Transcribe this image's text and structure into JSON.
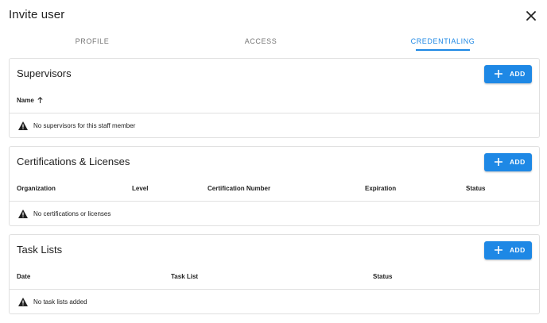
{
  "dialog": {
    "title": "Invite user",
    "close_icon": "close-icon"
  },
  "tabs": [
    {
      "label": "PROFILE",
      "active": false
    },
    {
      "label": "ACCESS",
      "active": false
    },
    {
      "label": "CREDENTIALING",
      "active": true
    }
  ],
  "colors": {
    "accent": "#1e88e5",
    "text": "#212121",
    "muted": "#757575",
    "border": "#e0e0e0"
  },
  "supervisors": {
    "title": "Supervisors",
    "add_label": "ADD",
    "columns": [
      "Name"
    ],
    "sort_icon": "arrow-up-icon",
    "empty_message": "No supervisors for this staff member"
  },
  "certifications": {
    "title": "Certifications & Licenses",
    "add_label": "ADD",
    "columns": [
      "Organization",
      "Level",
      "Certification Number",
      "Expiration",
      "Status"
    ],
    "empty_message": "No certifications or licenses"
  },
  "task_lists": {
    "title": "Task Lists",
    "add_label": "ADD",
    "columns": [
      "Date",
      "Task List",
      "Status"
    ],
    "empty_message": "No task lists added"
  }
}
